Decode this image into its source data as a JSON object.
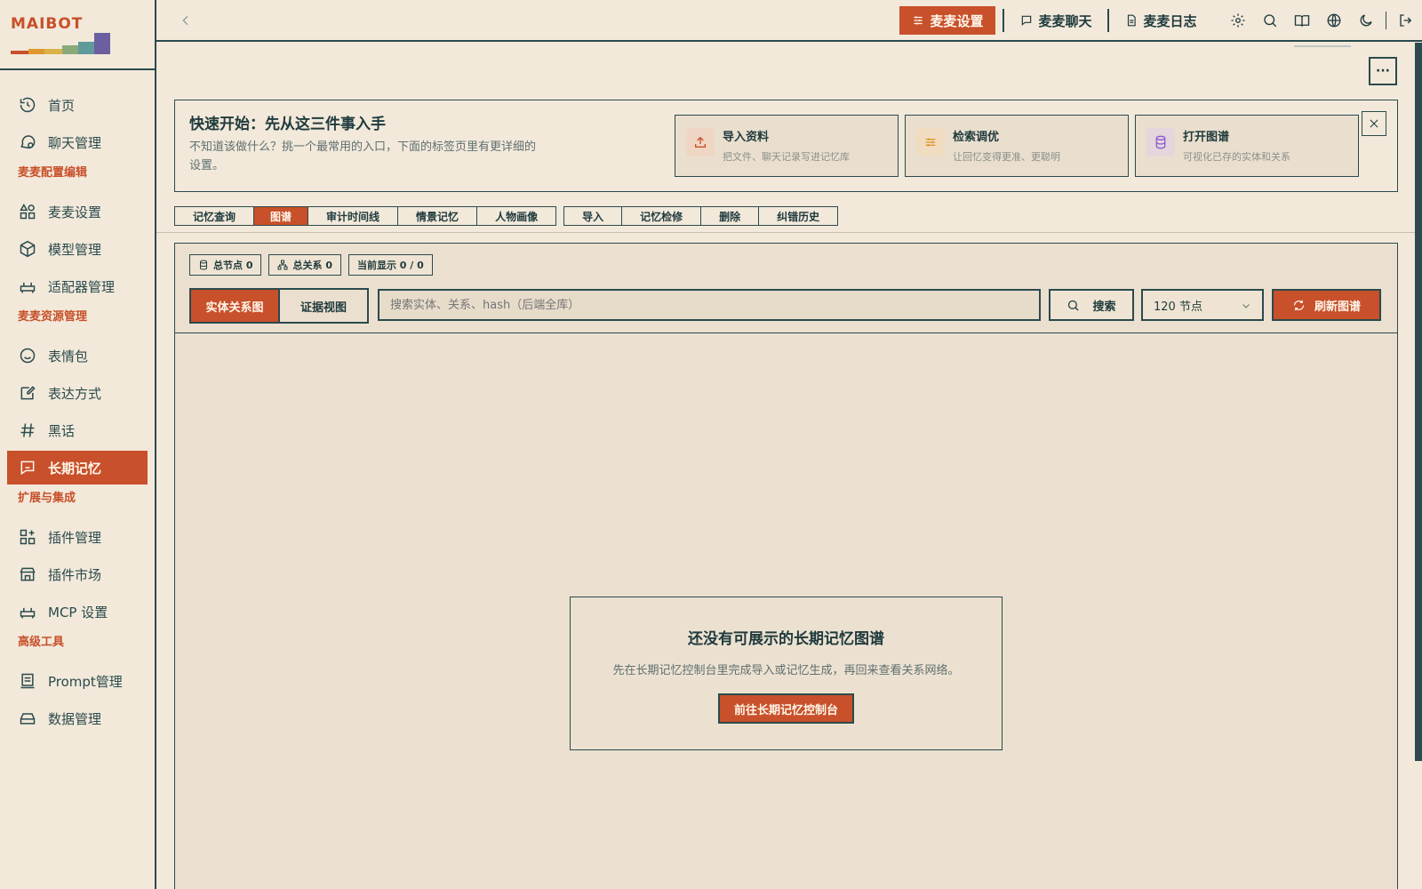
{
  "app": {
    "logo_text": "MAIBOT"
  },
  "sidebar": {
    "items": [
      {
        "label": "首页",
        "icon": "home-history-icon"
      },
      {
        "label": "聊天管理",
        "icon": "chat-icon"
      }
    ],
    "section_config": "麦麦配置编辑",
    "config_items": [
      {
        "label": "麦麦设置",
        "icon": "shapes-icon"
      },
      {
        "label": "模型管理",
        "icon": "cube-icon"
      },
      {
        "label": "适配器管理",
        "icon": "adapter-icon"
      }
    ],
    "section_resources": "麦麦资源管理",
    "resource_items": [
      {
        "label": "表情包",
        "icon": "smile-icon"
      },
      {
        "label": "表达方式",
        "icon": "edit-note-icon"
      },
      {
        "label": "黑话",
        "icon": "hash-icon"
      },
      {
        "label": "长期记忆",
        "icon": "memory-icon"
      }
    ],
    "section_extensions": "扩展与集成",
    "extension_items": [
      {
        "label": "插件管理",
        "icon": "plugin-grid-icon"
      },
      {
        "label": "插件市场",
        "icon": "store-icon"
      },
      {
        "label": "MCP 设置",
        "icon": "adapter-icon"
      }
    ],
    "section_advanced": "高级工具",
    "advanced_items": [
      {
        "label": "Prompt管理",
        "icon": "prompt-icon"
      },
      {
        "label": "数据管理",
        "icon": "drive-icon"
      }
    ]
  },
  "topbar": {
    "settings_label": "麦麦设置",
    "chat_label": "麦麦聊天",
    "log_label": "麦麦日志"
  },
  "quick_start": {
    "title": "快速开始：先从这三件事入手",
    "description": "不知道该做什么？挑一个最常用的入口，下面的标签页里有更详细的设置。",
    "cards": [
      {
        "title": "导入资料",
        "subtitle": "把文件、聊天记录写进记忆库",
        "icon": "upload-icon",
        "color": "#c8502a",
        "bg": "#efd6c4"
      },
      {
        "title": "检索调优",
        "subtitle": "让回忆变得更准、更聪明",
        "icon": "sliders-icon",
        "color": "#e0972e",
        "bg": "#f0dcc0"
      },
      {
        "title": "打开图谱",
        "subtitle": "可视化已存的实体和关系",
        "icon": "database-icon",
        "color": "#8a5bd0",
        "bg": "#e4d6dc"
      }
    ]
  },
  "tabs": {
    "group1": [
      "记忆查询",
      "图谱",
      "审计时间线",
      "情景记忆",
      "人物画像"
    ],
    "group2": [
      "导入",
      "记忆检修",
      "删除",
      "纠错历史"
    ],
    "active": "图谱"
  },
  "graph": {
    "stat_nodes": "总节点 0",
    "stat_edges": "总关系 0",
    "stat_display": "当前显示 0 / 0",
    "view_entity": "实体关系图",
    "view_evidence": "证据视图",
    "search_placeholder": "搜索实体、关系、hash（后端全库）",
    "search_label": "搜索",
    "node_count": "120 节点",
    "refresh_label": "刷新图谱",
    "empty_title": "还没有可展示的长期记忆图谱",
    "empty_desc": "先在长期记忆控制台里完成导入或记忆生成，再回来查看关系网络。",
    "empty_button": "前往长期记忆控制台"
  },
  "colors": {
    "accent": "#c8502a",
    "ink": "#1f3a3d",
    "background": "#f2e9da"
  }
}
